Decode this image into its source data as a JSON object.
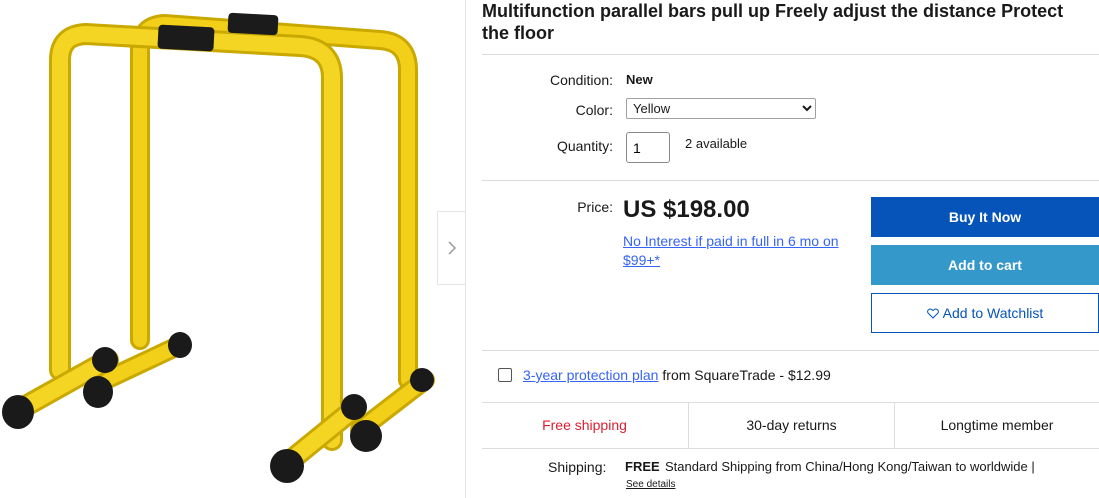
{
  "product": {
    "title": "Multifunction parallel bars pull up Freely adjust the distance Protect the floor",
    "image_alt": "Yellow parallel bars"
  },
  "details": {
    "condition_label": "Condition:",
    "condition_value": "New",
    "color_label": "Color:",
    "color_selected": "Yellow",
    "quantity_label": "Quantity:",
    "quantity_value": "1",
    "available": "2 available"
  },
  "pricing": {
    "price_label": "Price:",
    "price": "US $198.00",
    "financing": "No Interest if paid in full in 6 mo on $99+*"
  },
  "actions": {
    "buy_now": "Buy It Now",
    "add_to_cart": "Add to cart",
    "watchlist": "Add to Watchlist"
  },
  "protection": {
    "link": "3-year protection plan",
    "rest": "from SquareTrade - $12.99"
  },
  "highlights": [
    "Free shipping",
    "30-day returns",
    "Longtime member"
  ],
  "shipping": {
    "label": "Shipping:",
    "free": "FREE",
    "text": "Standard Shipping from China/Hong Kong/Taiwan to worldwide |",
    "see_details": "See details"
  },
  "colors": {
    "buy_now_bg": "#0654ba",
    "cart_bg": "#3498ca",
    "link": "#3665f3",
    "free_shipping": "#dd1e31",
    "product_yellow": "#f5d21f"
  },
  "icons": [
    "chevron-right-icon",
    "heart-icon",
    "dropdown-arrow-icon"
  ]
}
